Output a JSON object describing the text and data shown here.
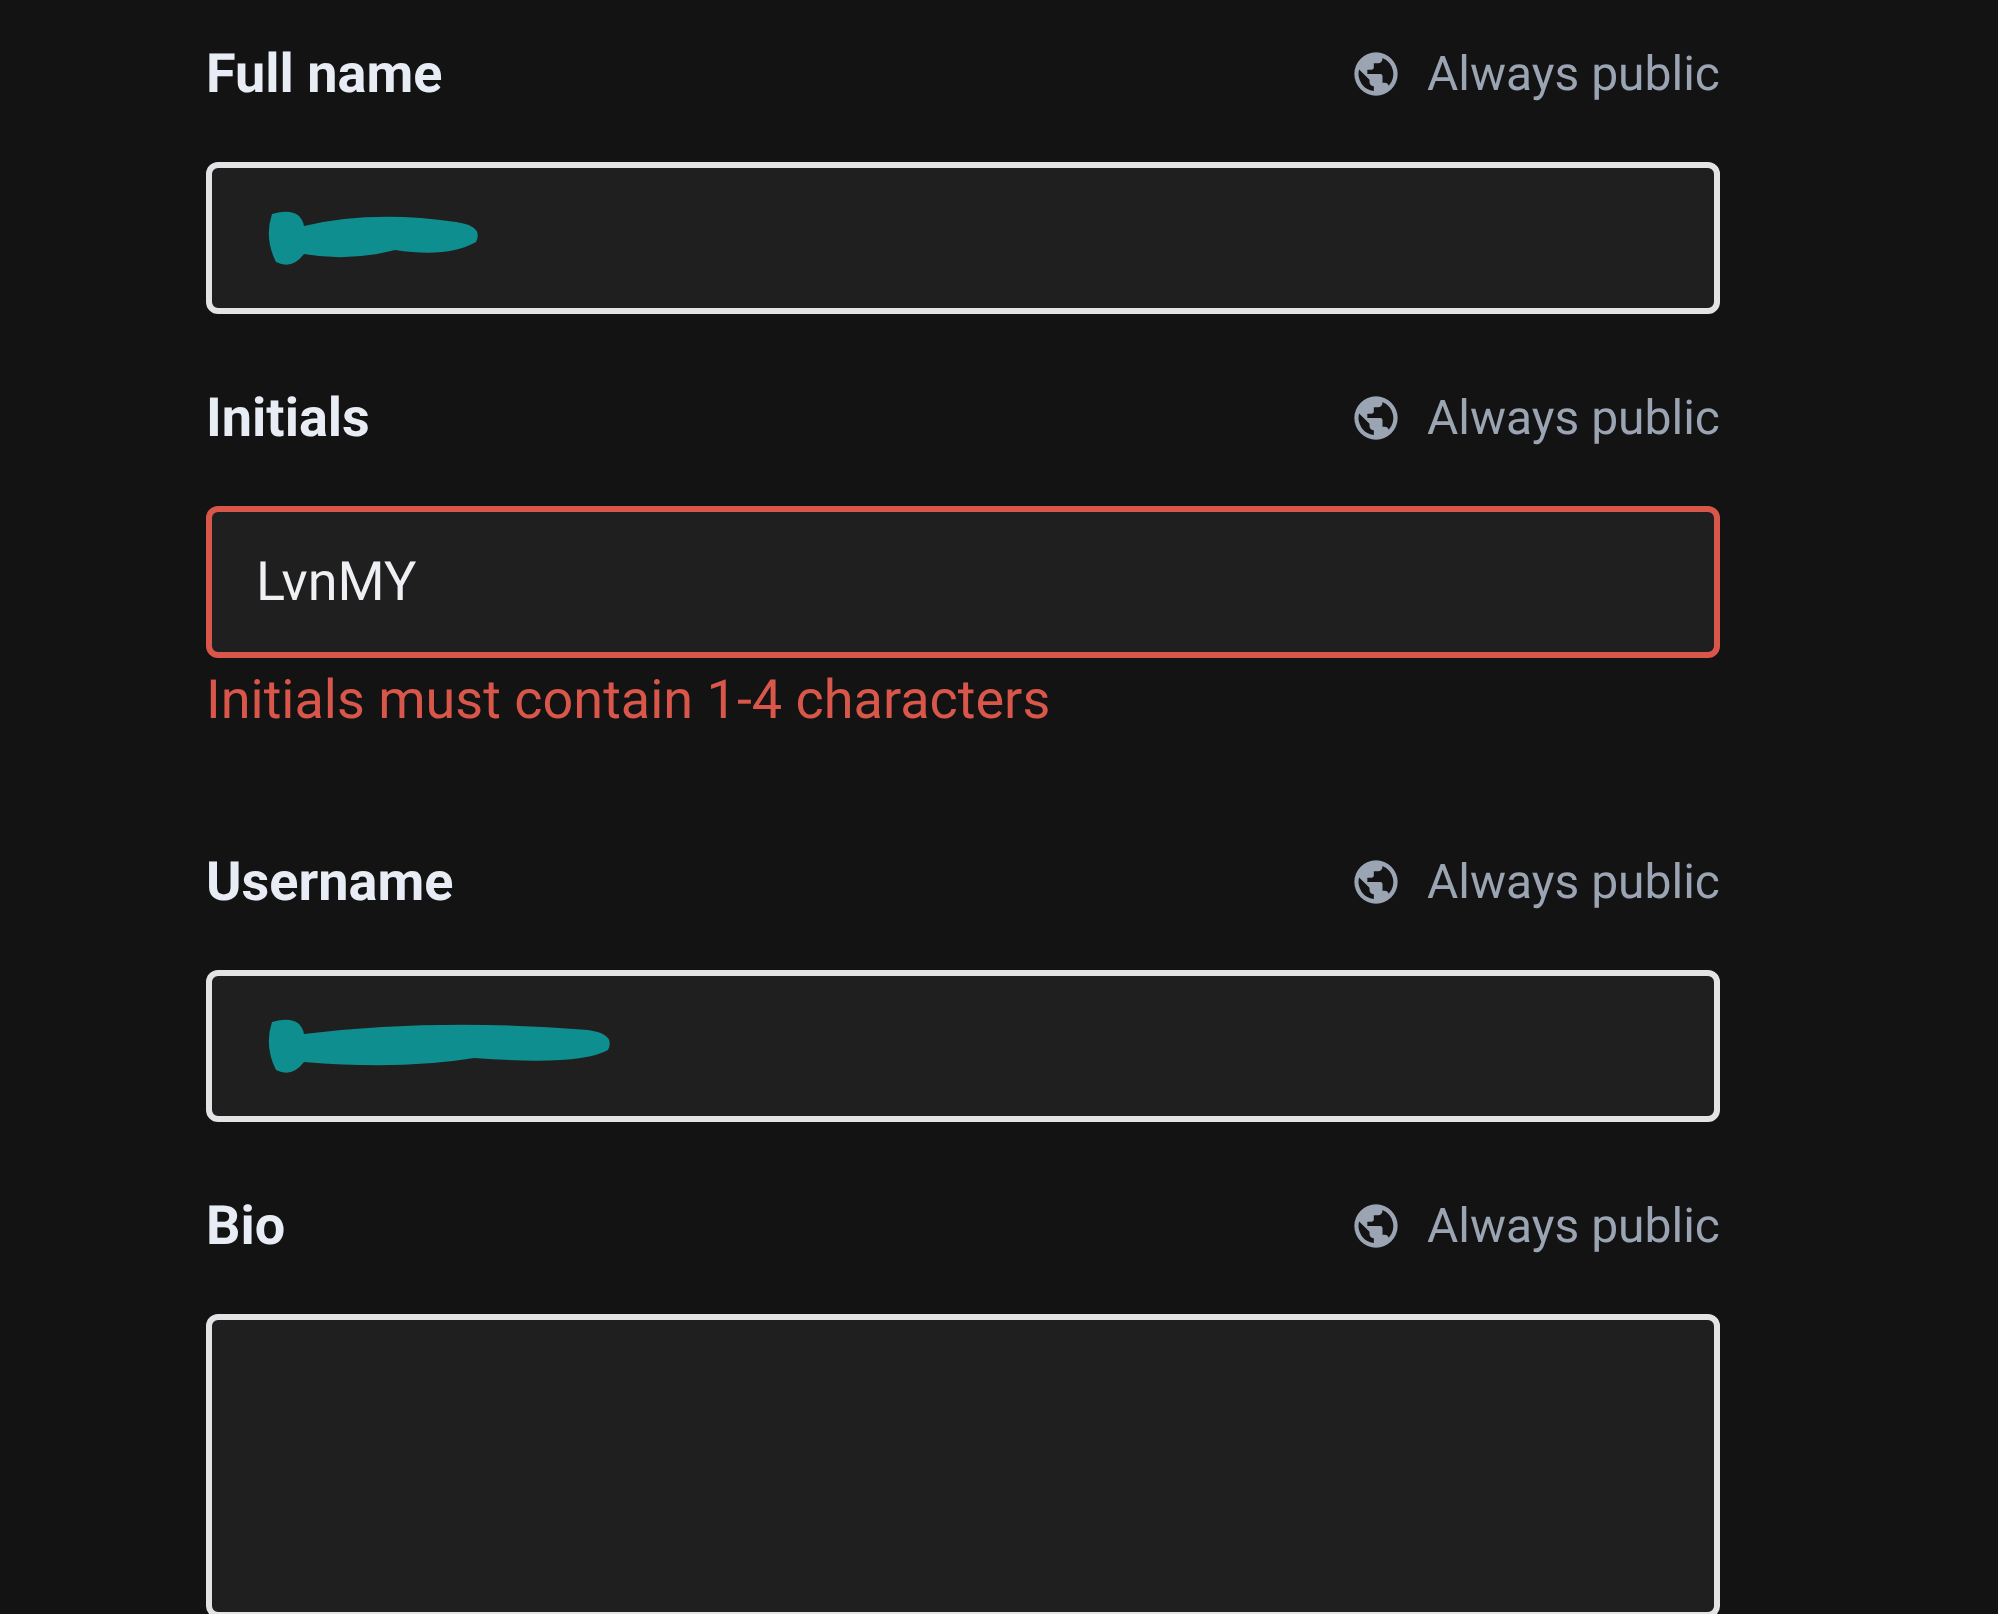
{
  "fields": [
    {
      "label": "Full name",
      "visibility": "Always public",
      "kind": "input",
      "value": {
        "kind": "redacted-short"
      }
    },
    {
      "label": "Initials",
      "visibility": "Always public",
      "kind": "input",
      "value": {
        "kind": "text",
        "text": "LvnMY"
      },
      "error": "Initials must contain 1-4 characters"
    },
    {
      "label": "Username",
      "visibility": "Always public",
      "kind": "input",
      "value": {
        "kind": "redacted-long"
      }
    },
    {
      "label": "Bio",
      "visibility": "Always public",
      "kind": "textarea"
    }
  ]
}
